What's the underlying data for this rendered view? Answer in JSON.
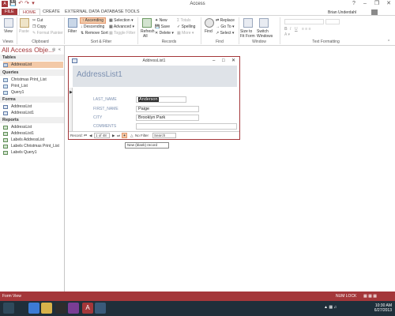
{
  "window": {
    "title": "Access",
    "user": "Brian Underdahl"
  },
  "tabs": [
    "FILE",
    "HOME",
    "CREATE",
    "EXTERNAL DATA",
    "DATABASE TOOLS"
  ],
  "ribbon": {
    "views": {
      "label": "View",
      "group": "Views"
    },
    "clipboard": {
      "paste": "Paste",
      "cut": "Cut",
      "copy": "Copy",
      "format_painter": "Format Painter",
      "group": "Clipboard"
    },
    "sort_filter": {
      "filter": "Filter",
      "ascending": "Ascending",
      "descending": "Descending",
      "remove_sort": "Remove Sort",
      "selection": "Selection",
      "advanced": "Advanced",
      "toggle_filter": "Toggle Filter",
      "group": "Sort & Filter"
    },
    "records": {
      "refresh": "Refresh",
      "refresh_all": "All",
      "new": "New",
      "save": "Save",
      "delete": "Delete",
      "totals": "Totals",
      "spelling": "Spelling",
      "more": "More",
      "group": "Records"
    },
    "find": {
      "find": "Find",
      "replace": "Replace",
      "goto": "Go To",
      "select": "Select",
      "group": "Find"
    },
    "window": {
      "size_to_fit": "Size to Fit Form",
      "switch_windows": "Switch Windows",
      "group": "Window"
    },
    "text_formatting": {
      "group": "Text Formatting"
    }
  },
  "nav": {
    "header": "All Access Obje...",
    "sections": [
      {
        "title": "Tables",
        "items": [
          "AddressList"
        ]
      },
      {
        "title": "Queries",
        "items": [
          "Christmas Print_List",
          "Print_List",
          "Query1"
        ]
      },
      {
        "title": "Forms",
        "items": [
          "AddressList",
          "AddressList1"
        ]
      },
      {
        "title": "Reports",
        "items": [
          "AddressList",
          "AddressList1",
          "Labels AddressList",
          "Labels Christmas Print_List",
          "Labels Query1"
        ]
      }
    ]
  },
  "form": {
    "window_title": "AddressList1",
    "header": "AddressList1",
    "fields": [
      {
        "label": "LAST_NAME",
        "value": "Anderson"
      },
      {
        "label": "FIRST_NAME",
        "value": "Paige"
      },
      {
        "label": "CITY",
        "value": "Brooklyn Park"
      },
      {
        "label": "COMMENTS",
        "value": ""
      }
    ],
    "record_nav": {
      "label": "Record:",
      "position": "1 of 48",
      "filter": "No Filter",
      "search": "Search"
    }
  },
  "tooltip": "New (blank) record",
  "status": {
    "left": "Form View",
    "num_lock": "NUM LOCK"
  },
  "taskbar": {
    "time": "10:30 AM",
    "date": "6/27/2013"
  },
  "colors": {
    "accent": "#a4373a",
    "selection": "#f3c9a7",
    "taskbar": "#1f2f3a"
  }
}
